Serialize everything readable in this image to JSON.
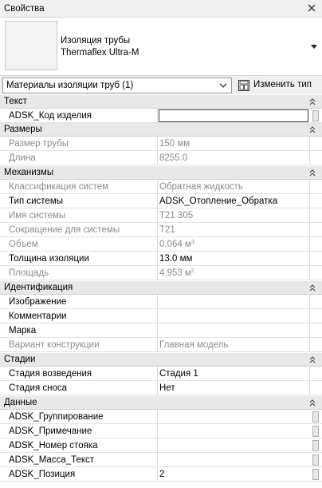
{
  "panel": {
    "title": "Свойства"
  },
  "type_selector": {
    "line1": "Изоляция трубы",
    "line2": "Thermaflex Ultra-M"
  },
  "filter": {
    "selected": "Материалы изоляции труб (1)",
    "edit_type_label": "Изменить тип"
  },
  "groups": {
    "text": "Текст",
    "sizes": "Размеры",
    "mechanisms": "Механизмы",
    "identity": "Идентификация",
    "phases": "Стадии",
    "data": "Данные"
  },
  "rows": {
    "r0": {
      "name": "ADSK_Код изделия",
      "value": ""
    },
    "r1": {
      "name": "Размер трубы",
      "value": "150 мм"
    },
    "r2": {
      "name": "Длина",
      "value": "8255.0"
    },
    "r3": {
      "name": "Классификация систем",
      "value": "Обратная жидкость"
    },
    "r4": {
      "name": "Тип системы",
      "value": "ADSK_Отопление_Обратка"
    },
    "r5": {
      "name": "Имя системы",
      "value": "Т21 305"
    },
    "r6": {
      "name": "Сокращение для системы",
      "value": "Т21"
    },
    "r7": {
      "name": "Объем",
      "value": "0.064 м",
      "sup": "3"
    },
    "r8": {
      "name": "Толщина изоляции",
      "value": "13.0 мм"
    },
    "r9": {
      "name": "Площадь",
      "value": "4.953 м",
      "sup": "2"
    },
    "r10": {
      "name": "Изображение",
      "value": ""
    },
    "r11": {
      "name": "Комментарии",
      "value": ""
    },
    "r12": {
      "name": "Марка",
      "value": ""
    },
    "r13": {
      "name": "Вариант конструкции",
      "value": "Главная модель"
    },
    "r14": {
      "name": "Стадия возведения",
      "value": "Стадия 1"
    },
    "r15": {
      "name": "Стадия сноса",
      "value": "Нет"
    },
    "r16": {
      "name": "ADSK_Группирование",
      "value": ""
    },
    "r17": {
      "name": "ADSK_Примечание",
      "value": ""
    },
    "r18": {
      "name": "ADSK_Номер стояка",
      "value": ""
    },
    "r19": {
      "name": "ADSK_Масса_Текст",
      "value": ""
    },
    "r20": {
      "name": "ADSK_Позиция",
      "value": "2"
    }
  },
  "icons": {
    "close": "close-icon",
    "dropdown": "chevron-down-icon",
    "edit_type": "edit-type-icon",
    "collapse": "collapse-chevron-icon"
  },
  "colors": {
    "group_bg": "#e8e8e8",
    "disabled_text": "#8c8c8c"
  }
}
